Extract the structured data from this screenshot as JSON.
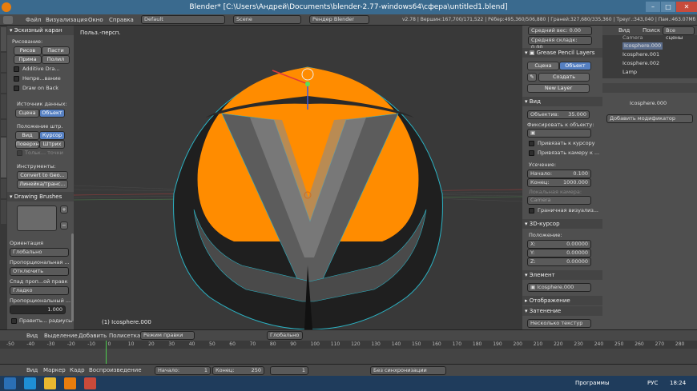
{
  "window": {
    "title": "Blender* [C:\\Users\\Андрей\\Documents\\blender-2.77-windows64\\сфера\\untitled1.blend]"
  },
  "info": {
    "menus": [
      "Файл",
      "Визуализация",
      "Окно",
      "Справка"
    ],
    "layout": "Default",
    "scene": "Scene",
    "engine": "Рендер Blender",
    "stats": "v2.78 | Вершин:167,700/171,522 | Рёбер:495,360/506,880 | Граней:327,680/335,360 | Треуг.:343,040 | Пам.:463.07Мб | Icosphere.000"
  },
  "left": {
    "tab_title": "Эскизный каран",
    "draw_label": "Рисование:",
    "draw_btns": [
      "Рисов",
      "Пасти",
      "Прима",
      "Полил"
    ],
    "additive": "Additive Dra...",
    "continuous": "Непре...вание",
    "draw_back": "Draw on Back",
    "source_label": "Источник данных:",
    "source_btns": [
      "Сцена",
      "Объект"
    ],
    "pos_label": "Положение штр.",
    "pos_btns": [
      "Вид",
      "Курсор",
      "Поверхн",
      "Штрих"
    ],
    "only_label": "Тольк... точки",
    "tools_label": "Инструменты:",
    "tools": [
      "Convert to Geo...",
      "Линейка/транс..."
    ],
    "brushes_hdr": "Drawing Brushes",
    "orient_label": "Ориентация",
    "orient": "Глобально",
    "prop_label": "Пропорциональная ...",
    "prop": "Отключить",
    "falloff_label": "Спад проп...ой правк",
    "falloff": "Гладко",
    "size_label": "Пропорциональный ...",
    "size": "1.000",
    "edit_label": "Править... радиусы"
  },
  "vtabs": [
    "Инструменты",
    "Создать",
    "Связи",
    "Затенение/UV",
    "Опции",
    "Эскизный каран",
    "Физика",
    "3D-Печать"
  ],
  "viewport": {
    "label": "Польз.-персп.",
    "obj": "(1) Icosphere.000"
  },
  "props": {
    "avg_weight": "Средний вес: 0.00",
    "avg_crease": "Средняя складк: 0.00",
    "gp_hdr": "Grease Pencil Layers",
    "gp_tabs": [
      "Сцена",
      "Объект"
    ],
    "create": "Создать",
    "new_layer": "New Layer",
    "view_hdr": "Вид",
    "lens": "Объектив:",
    "lens_val": "35.000",
    "lock_label": "Фиксировать к объекту:",
    "lock_cursor": "Привязать к курсору",
    "lock_cam": "Привязать камеру к ...",
    "clip_label": "Усечение:",
    "clip_start": "Начало:",
    "clip_start_val": "0.100",
    "clip_end": "Конец:",
    "clip_end_val": "1000.000",
    "local_cam": "Локальная камера:",
    "camera": "Camera",
    "border": "Граничная визуализ...",
    "cursor_hdr": "3D-курсор",
    "location": "Положение:",
    "x": "X:",
    "y": "Y:",
    "z": "Z:",
    "cval": "0.00000",
    "item_hdr": "Элемент",
    "item": "Icosphere.000",
    "display_hdr": "Отображение",
    "shading_hdr": "Затенение",
    "multitex": "Несколько текстур"
  },
  "outliner": {
    "tabs": [
      "Вид",
      "Поиск",
      "Все сцены"
    ],
    "items": [
      "Camera",
      "Icosphere.000",
      "Icosphere.001",
      "Icosphere.002",
      "Lamp"
    ]
  },
  "modifiers": {
    "obj": "Icosphere.000",
    "add": "Добавить модификатор"
  },
  "v3dheader": {
    "items": [
      "Вид",
      "Выделение",
      "Добавить",
      "Полисетка"
    ],
    "mode": "Режим правки",
    "orient": "Глобально"
  },
  "timeline": {
    "ticks": [
      "-50",
      "-40",
      "-30",
      "-20",
      "-10",
      "0",
      "10",
      "20",
      "30",
      "40",
      "50",
      "60",
      "70",
      "80",
      "90",
      "100",
      "110",
      "120",
      "130",
      "140",
      "150",
      "160",
      "170",
      "180",
      "190",
      "200",
      "210",
      "220",
      "230",
      "240",
      "250",
      "260",
      "270",
      "280"
    ],
    "menus": [
      "Вид",
      "Маркер",
      "Кадр",
      "Воспроизведение"
    ],
    "start": "Начало:",
    "start_val": "1",
    "end": "Конец:",
    "end_val": "250",
    "current": "1",
    "sync": "Без синхронизации"
  },
  "taskbar": {
    "programs": "Программы",
    "lang": "РУС",
    "time": "18:24"
  },
  "colors": {
    "accent": "#5680c2",
    "sphere": "#ff8c00",
    "title": "#3a6a8e"
  }
}
